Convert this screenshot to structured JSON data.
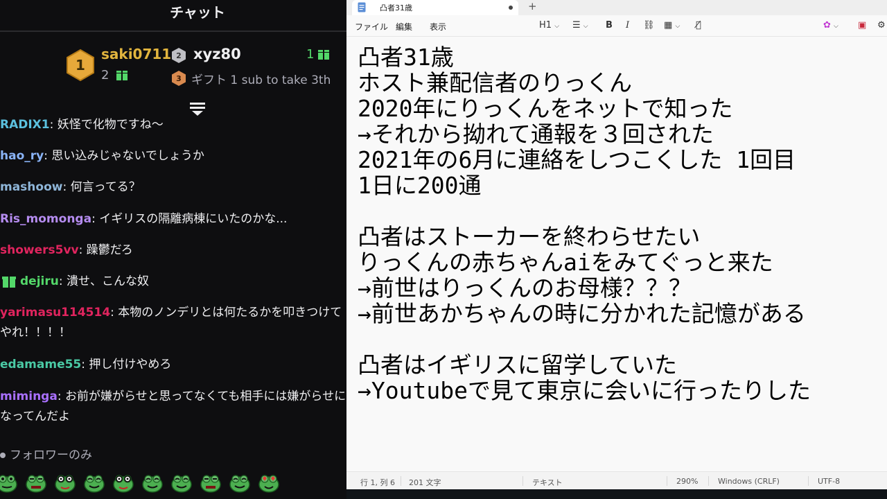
{
  "chat": {
    "title": "チャット",
    "leaderboard": {
      "first": {
        "rank": "1",
        "user": "saki0711",
        "count": "2"
      },
      "second": {
        "rank": "2",
        "user": "xyz80",
        "count": "1"
      },
      "third": {
        "rank": "3",
        "text": "ギフト 1 sub to take 3th"
      }
    },
    "messages": [
      {
        "user": "RADIX1",
        "sep": ": ",
        "text": "妖怪で化物ですね～",
        "color": "#5bc0de"
      },
      {
        "user": "hao_ry",
        "sep": ": ",
        "text": "思い込みじゃないでしょうか",
        "color": "#8ab4f8"
      },
      {
        "user": "mashoow",
        "sep": ": ",
        "text": "何言ってる？",
        "color": "#8fb6d9"
      },
      {
        "user": "Ris_momonga",
        "sep": ": ",
        "text": "イギリスの隔離病棟にいたのかな...",
        "color": "#b58cf0"
      },
      {
        "user": "showers5vv",
        "sep": ": ",
        "text": "躁鬱だろ",
        "color": "#e0245e"
      },
      {
        "user": "dejiru",
        "sep": ": ",
        "text": "潰せ、こんな奴",
        "color": "#53d769"
      },
      {
        "user": "yarimasu114514",
        "sep": ": ",
        "text": "本物のノンデリとは何たるかを叩きつけてやれ！！！！",
        "color": "#e0245e"
      },
      {
        "user": "edamame55",
        "sep": ": ",
        "text": "押し付けやめろ",
        "color": "#4ac9a4"
      },
      {
        "user": "mimingа",
        "sep": ": ",
        "text": "お前が嫌がらせと思ってなくても相手には嫌がらせになってんだよ",
        "color": "#a970ff"
      }
    ],
    "followers_only": "フォロワーのみ",
    "emotes": [
      "frog-emote",
      "frog-angry-emote",
      "frog-glasses-emote",
      "frog-smile-emote",
      "frog-glasses-emote",
      "frog-smile-emote",
      "frog-smile-emote",
      "frog-angry-emote",
      "frog-smile-emote",
      "frog-love-emote"
    ]
  },
  "notepad": {
    "tab_title": "凸者31歳",
    "new_tab": "+",
    "menu": {
      "file": "ファイル",
      "edit": "編集",
      "view": "表示"
    },
    "toolbar": {
      "heading": "H1",
      "bold": "B",
      "italic": "I"
    },
    "lines": [
      "凸者31歳",
      "ホスト兼配信者のりっくん",
      "2020年にりっくんをネットで知った",
      "→それから拗れて通報を３回された",
      "2021年の6月に連絡をしつこくした 1回目",
      "1日に200通",
      "",
      "凸者はストーカーを終わらせたい",
      "りっくんの赤ちゃんaiをみてぐっと来た",
      "→前世はりっくんのお母様？？？",
      "→前世あかちゃんの時に分かれた記憶がある",
      "",
      "凸者はイギリスに留学していた",
      "→Youtubeで見て東京に会いに行ったりした"
    ],
    "status": {
      "position": "行 1, 列 6",
      "chars": "201 文字",
      "mode": "テキスト",
      "zoom": "290%",
      "line_ending": "Windows (CRLF)",
      "encoding": "UTF-8"
    }
  }
}
